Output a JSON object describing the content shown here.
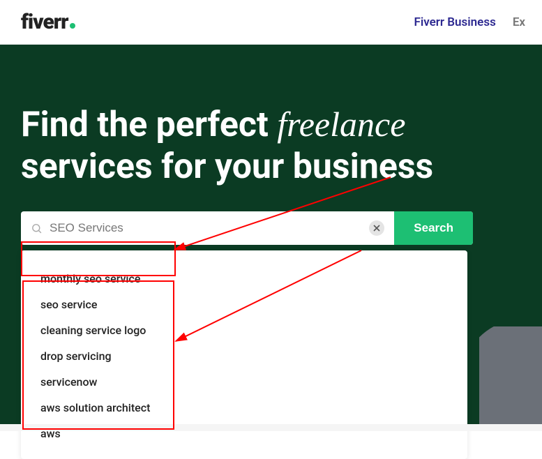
{
  "header": {
    "logo_text": "fiverr",
    "nav": {
      "business": "Fiverr Business",
      "explore": "Ex"
    }
  },
  "hero": {
    "heading_prefix": "Find the perfect ",
    "heading_italic": "freelance",
    "heading_suffix": " services for your business"
  },
  "search": {
    "value": "SEO Services",
    "button": "Search",
    "suggestions": [
      "monthly seo service",
      "seo service",
      "cleaning service logo",
      "drop servicing",
      "servicenow",
      "aws solution architect",
      "aws"
    ]
  },
  "colors": {
    "brand_green": "#1dbf73",
    "hero_bg": "#0b3b23",
    "annotation": "#ff0000",
    "nav_link": "#2d2991"
  }
}
